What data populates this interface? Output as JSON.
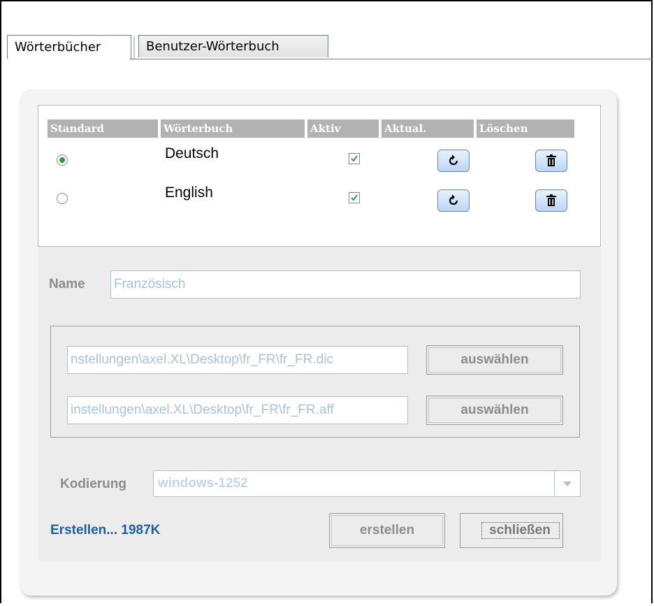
{
  "tabs": [
    {
      "label": "Wörterbücher",
      "active": true
    },
    {
      "label": "Benutzer-Wörterbuch",
      "active": false
    }
  ],
  "table": {
    "headers": [
      "Standard",
      "Wörterbuch",
      "Aktiv",
      "Aktual.",
      "Löschen"
    ],
    "rows": [
      {
        "name": "Deutsch",
        "standard": true,
        "active": true
      },
      {
        "name": "English",
        "standard": false,
        "active": true
      }
    ]
  },
  "form": {
    "name_label": "Name",
    "name_placeholder": "Französisch",
    "dic_path": "nstellungen\\axel.XL\\Desktop\\fr_FR\\fr_FR.dic",
    "aff_path": "instellungen\\axel.XL\\Desktop\\fr_FR\\fr_FR.aff",
    "choose_label": "auswählen",
    "encoding_label": "Kodierung",
    "encoding_value": "windows-1252"
  },
  "status_text": "Erstellen... 1987K",
  "buttons": {
    "create": "erstellen",
    "close": "schließen"
  },
  "colors": {
    "header_bg": "#b2b2b2",
    "status_text": "#1d5f9c",
    "check_green": "#2f9a3a",
    "icon_button": "#bcd6f5"
  },
  "icons": {
    "refresh": "refresh-icon",
    "delete": "trash-icon",
    "dropdown": "chevron-down-icon"
  }
}
